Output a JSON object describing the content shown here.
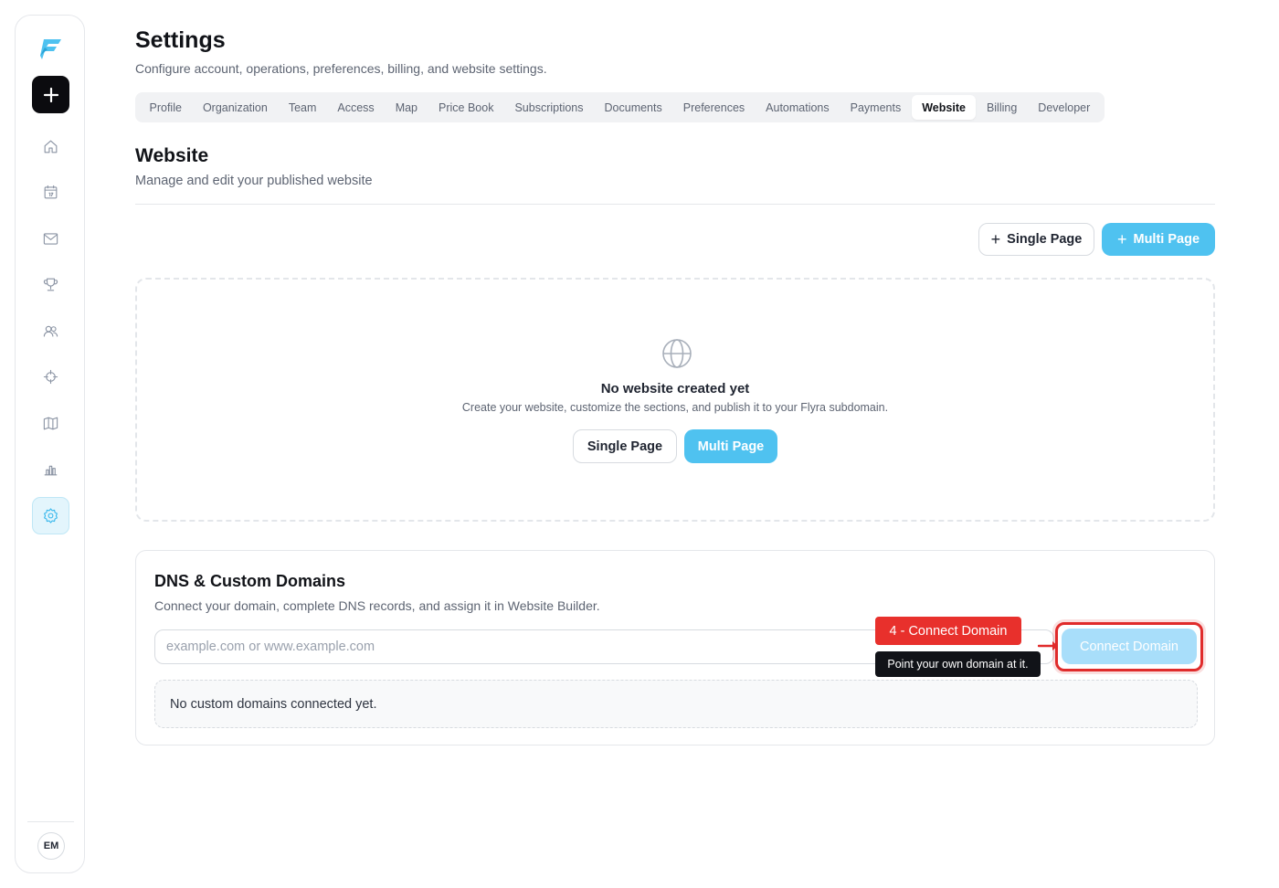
{
  "sidebar": {
    "logo_icon": "flyra-logo-icon",
    "add_label": "+",
    "nav": [
      {
        "icon": "home-icon"
      },
      {
        "icon": "calendar-icon"
      },
      {
        "icon": "mail-icon"
      },
      {
        "icon": "trophy-icon"
      },
      {
        "icon": "users-icon"
      },
      {
        "icon": "crosshair-icon"
      },
      {
        "icon": "map-icon"
      },
      {
        "icon": "bar-chart-icon"
      },
      {
        "icon": "gear-icon",
        "active": true
      }
    ],
    "avatar_initials": "EM"
  },
  "header": {
    "title": "Settings",
    "subtitle": "Configure account, operations, preferences, billing, and website settings."
  },
  "tabs": [
    "Profile",
    "Organization",
    "Team",
    "Access",
    "Map",
    "Price Book",
    "Subscriptions",
    "Documents",
    "Preferences",
    "Automations",
    "Payments",
    "Website",
    "Billing",
    "Developer"
  ],
  "active_tab": "Website",
  "website": {
    "title": "Website",
    "subtitle": "Manage and edit your published website",
    "single_page_label": "Single Page",
    "multi_page_label": "Multi Page",
    "empty": {
      "icon": "globe-icon",
      "title": "No website created yet",
      "description": "Create your website, customize the sections, and publish it to your Flyra subdomain.",
      "single_page_label": "Single Page",
      "multi_page_label": "Multi Page"
    }
  },
  "dns": {
    "title": "DNS & Custom Domains",
    "description": "Connect your domain, complete DNS records, and assign it in Website Builder.",
    "input_placeholder": "example.com or www.example.com",
    "connect_label": "Connect Domain",
    "empty_text": "No custom domains connected yet."
  },
  "annotation": {
    "step_label": "4 - Connect Domain",
    "tooltip": "Point your own domain at it."
  },
  "colors": {
    "accent": "#4fc2f0",
    "accent_disabled": "#a8defa",
    "highlight": "#e02b2b"
  }
}
